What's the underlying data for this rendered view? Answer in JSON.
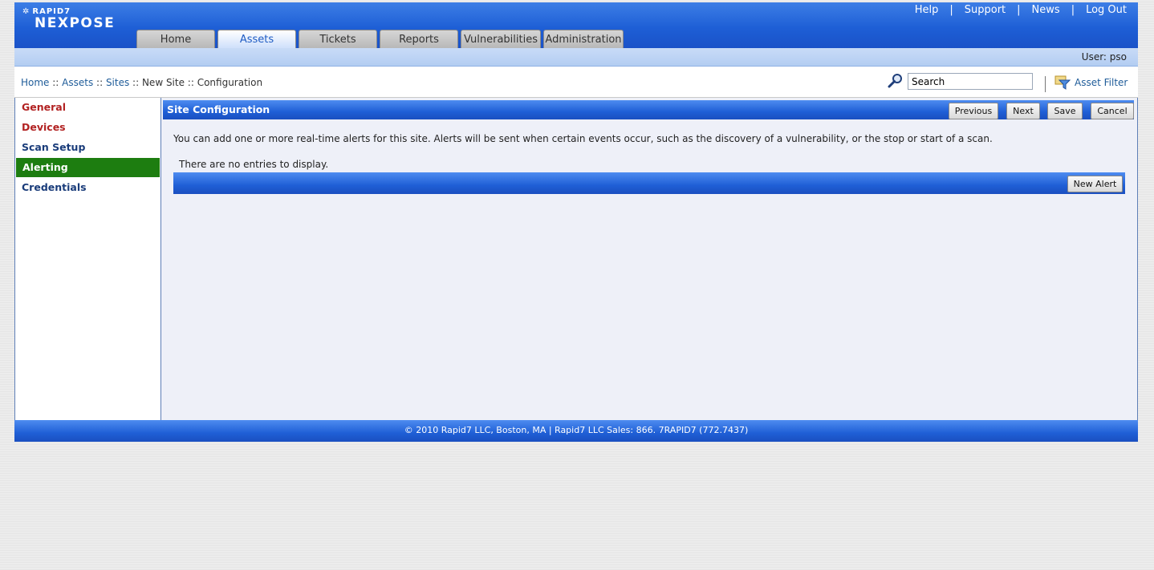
{
  "brand": {
    "company": "RAPID7",
    "product": "NEXPOSE"
  },
  "util_nav": {
    "help": "Help",
    "support": "Support",
    "news": "News",
    "logout": "Log Out",
    "separator": "|"
  },
  "tabs": [
    {
      "label": "Home"
    },
    {
      "label": "Assets"
    },
    {
      "label": "Tickets"
    },
    {
      "label": "Reports"
    },
    {
      "label": "Vulnerabilities"
    },
    {
      "label": "Administration"
    }
  ],
  "active_tab": "Assets",
  "user_bar": {
    "text": "User: pso"
  },
  "breadcrumb": {
    "items": [
      "Home",
      "Assets",
      "Sites",
      "New Site",
      "Configuration"
    ],
    "separator": " :: "
  },
  "search": {
    "value": "Search"
  },
  "asset_filter": {
    "label": "Asset Filter"
  },
  "sidebar": {
    "items": [
      {
        "label": "General"
      },
      {
        "label": "Devices"
      },
      {
        "label": "Scan Setup"
      },
      {
        "label": "Alerting"
      },
      {
        "label": "Credentials"
      }
    ],
    "active": "Alerting"
  },
  "panel": {
    "title": "Site Configuration",
    "buttons": {
      "previous": "Previous",
      "next": "Next",
      "save": "Save",
      "cancel": "Cancel"
    },
    "intro": "You can add one or more real-time alerts for this site. Alerts will be sent when certain events occur, such as the discovery of a vulnerability, or the stop or start of a scan.",
    "empty_message": "There are no entries to display.",
    "new_alert_label": "New Alert"
  },
  "footer": {
    "text": "© 2010 Rapid7 LLC, Boston, MA | Rapid7 LLC Sales: 866. 7RAPID7 (772.7437)"
  },
  "colors": {
    "header_blue": "#1e5fd6",
    "active_green": "#1d7d10",
    "link_blue": "#1f5c99",
    "sidebar_red": "#b22222"
  }
}
